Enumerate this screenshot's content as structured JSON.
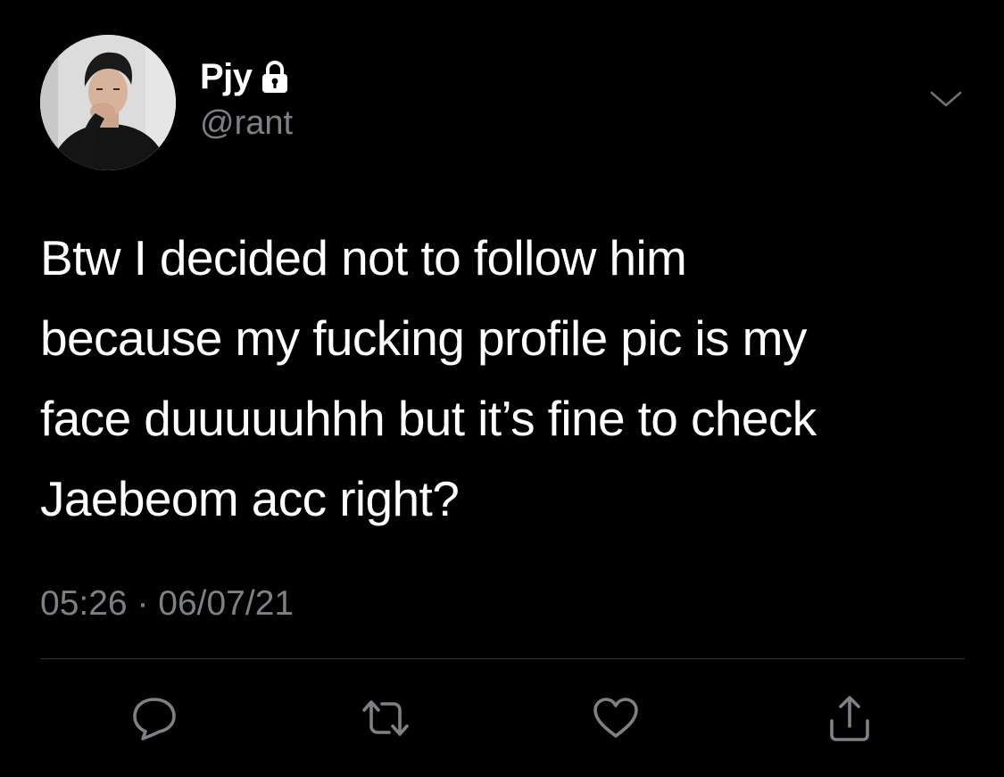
{
  "tweet": {
    "author": {
      "display_name": "Pjy",
      "handle": "@rant",
      "protected_icon": "lock-icon"
    },
    "menu_icon": "chevron-down-icon",
    "text": "Btw I decided not to follow him\nbecause my fucking profile pic is my\nface duuuuuhhh but it’s fine to check\nJaebeom acc right?",
    "time": "05:26",
    "separator": " · ",
    "date": "06/07/21",
    "actions": [
      {
        "name": "reply",
        "icon": "reply-icon"
      },
      {
        "name": "retweet",
        "icon": "retweet-icon"
      },
      {
        "name": "like",
        "icon": "heart-icon"
      },
      {
        "name": "share",
        "icon": "share-icon"
      }
    ]
  },
  "colors": {
    "background": "#000000",
    "primary_text": "#ffffff",
    "secondary_text": "#7d8085",
    "divider": "#2f3336",
    "icon": "#7d8085"
  }
}
